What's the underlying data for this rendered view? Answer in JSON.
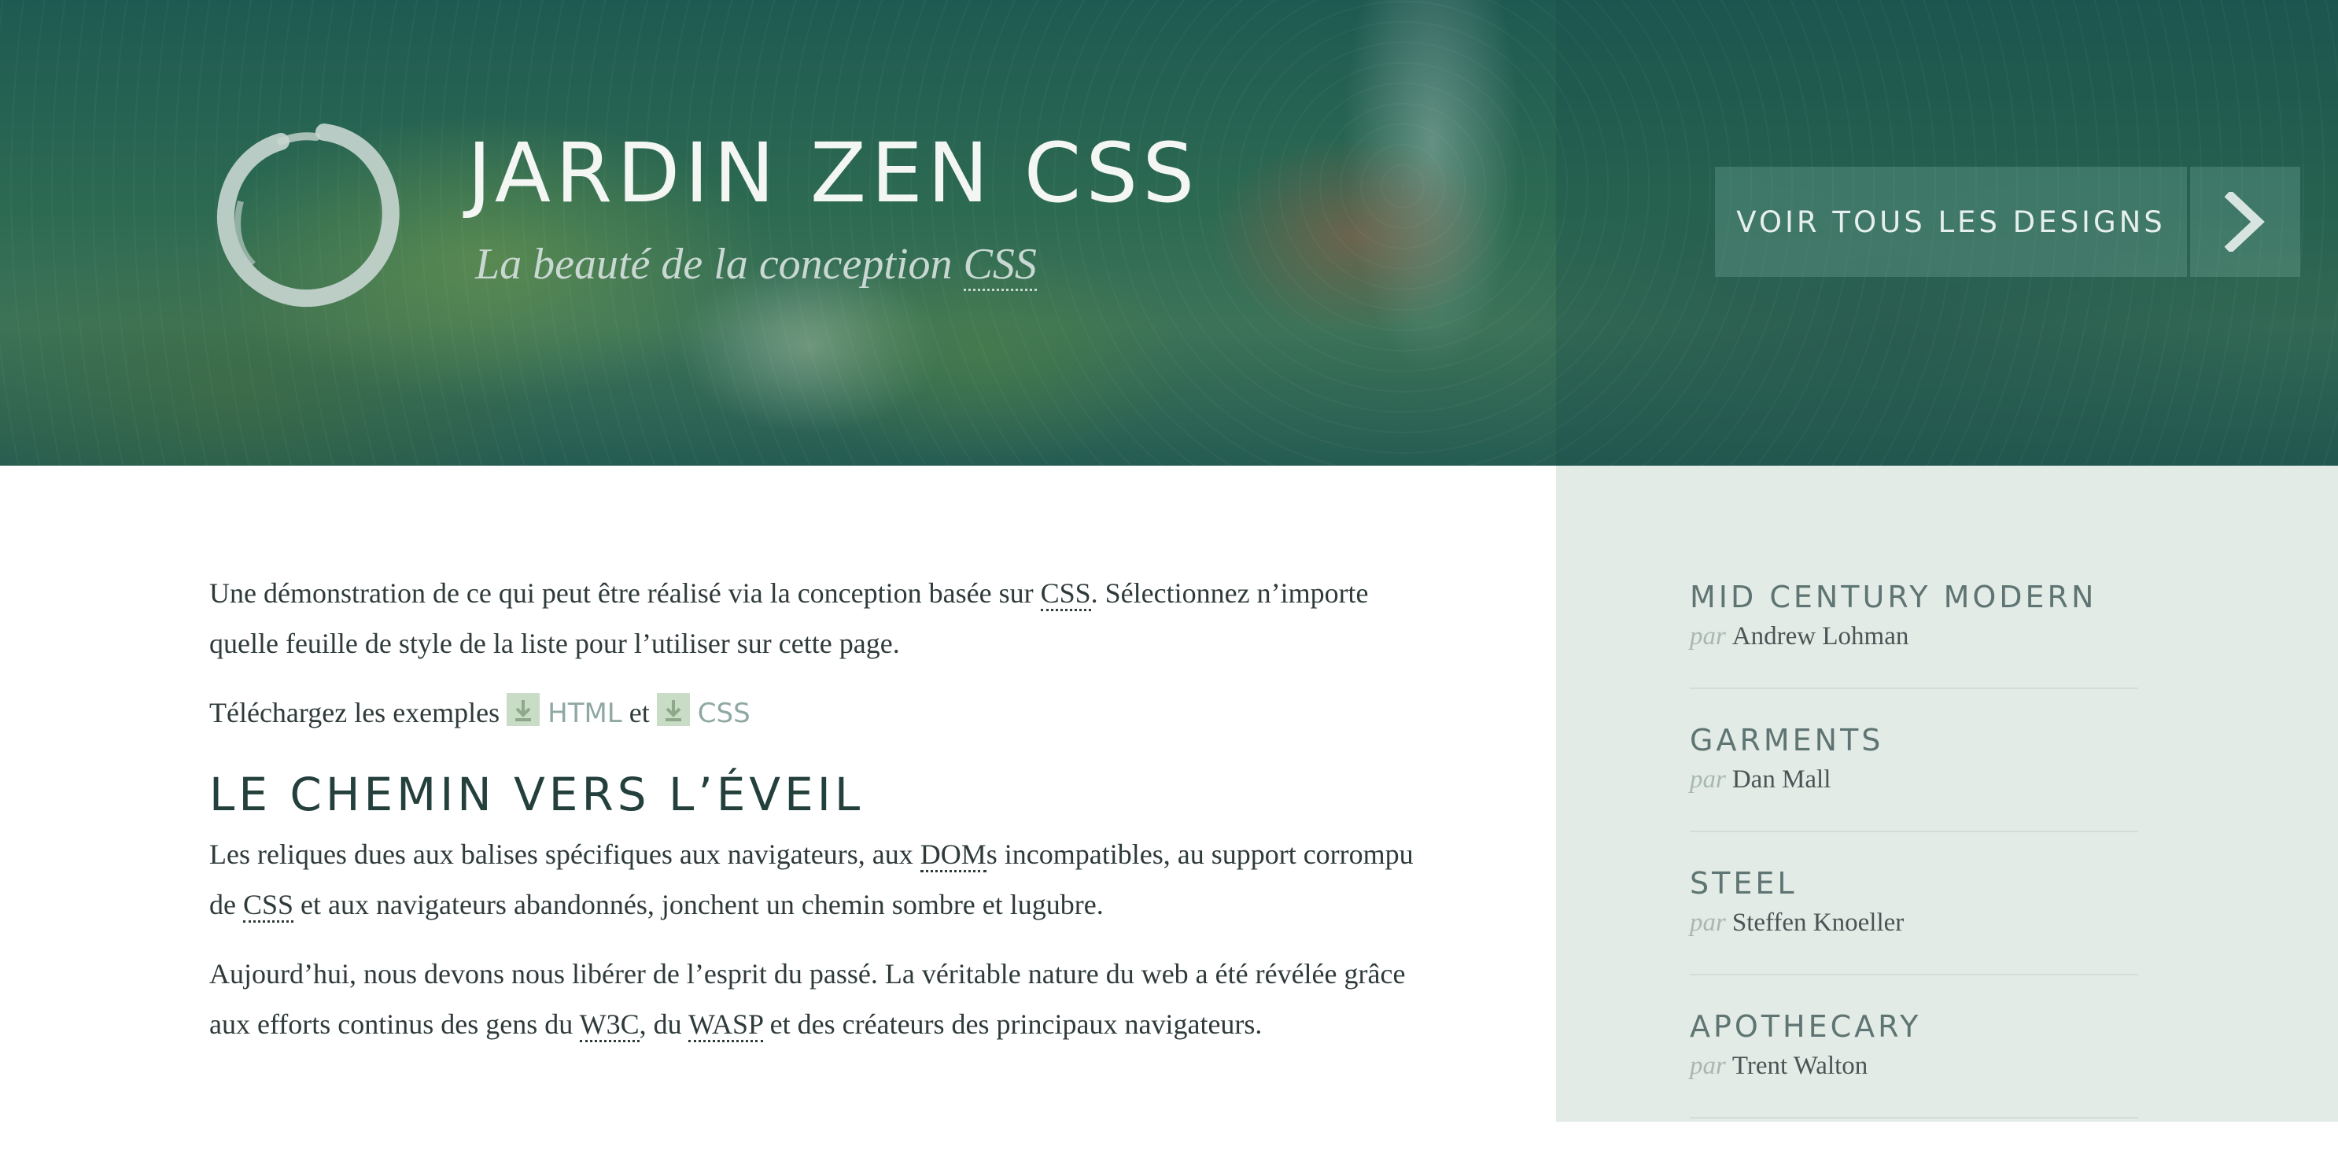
{
  "header": {
    "title": "JARDIN ZEN CSS",
    "subtitle_prefix": "La beauté de la conception ",
    "subtitle_abbr": "CSS",
    "view_all_label": "VOIR TOUS LES DESIGNS"
  },
  "main": {
    "intro": {
      "part1": "Une démonstration de ce qui peut être réalisé via la conception basée sur ",
      "abbr": "CSS",
      "part2": ". Sélectionnez n’importe quelle feuille de style de la liste pour l’utiliser sur cette page."
    },
    "download": {
      "prefix": "Téléchargez les exemples ",
      "html_label": "HTML",
      "middle": " et ",
      "css_label": "CSS"
    },
    "section_heading": "LE CHEMIN VERS L’ÉVEIL",
    "para1": {
      "part1": "Les reliques dues aux balises spécifiques aux navigateurs, aux ",
      "abbr_dom": "DOM",
      "part2": "s incompatibles, au support corrompu de ",
      "abbr_css": "CSS",
      "part3": " et aux navigateurs abandonnés, jonchent un chemin sombre et lugubre."
    },
    "para2": {
      "part1": "Aujourd’hui, nous devons nous libérer de l’esprit du passé. La véritable nature du web a été révélée grâce aux efforts continus des gens du ",
      "abbr_w3c": "W3C",
      "part2": ", du ",
      "abbr_wasp": "WASP",
      "part3": " et des créateurs des principaux navigateurs."
    }
  },
  "sidebar": {
    "by_label": "par",
    "designs": [
      {
        "name": "MID CENTURY MODERN",
        "author": "Andrew Lohman"
      },
      {
        "name": "GARMENTS",
        "author": "Dan Mall"
      },
      {
        "name": "STEEL",
        "author": "Steffen Knoeller"
      },
      {
        "name": "APOTHECARY",
        "author": "Trent Walton"
      }
    ]
  },
  "colors": {
    "header_green": "#1f5a52",
    "sidebar_bg": "#e3ebe6",
    "text": "#2f3a3a",
    "link_muted": "#8fa8a3",
    "heading": "#24403c"
  },
  "icons": [
    "enso-logo-icon",
    "chevron-right-icon",
    "download-icon"
  ]
}
